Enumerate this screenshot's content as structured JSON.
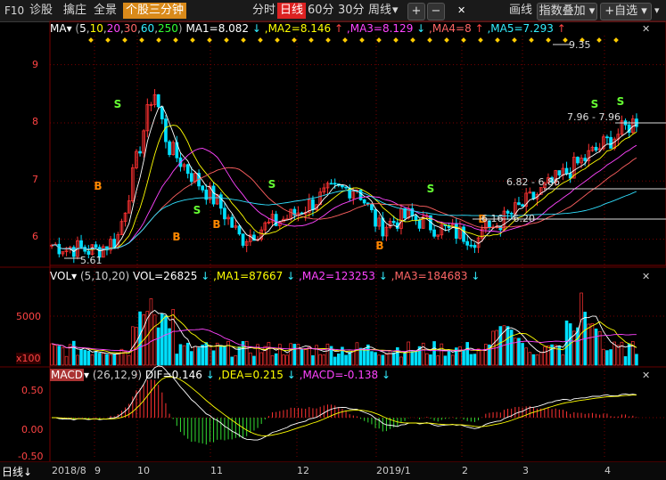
{
  "toolbar": {
    "f10": "F10",
    "diagnose": "诊股",
    "fetch": "擒庄",
    "fullscreen": "全景",
    "three_min": "个股三分钟",
    "periods": [
      "分时",
      "日线",
      "60分",
      "30分",
      "周线"
    ],
    "period_dropdown": "▾",
    "plus": "+",
    "minus": "−",
    "close": "✕",
    "draw_line": "画线",
    "index_overlay": "指数叠加",
    "add_watch": "+自选"
  },
  "colors": {
    "bg": "#000000",
    "up": "#ff3232",
    "down": "#00e0ff",
    "ma1": "#ffffff",
    "ma2": "#ffff00",
    "ma3": "#ff44ff",
    "ma4": "#ff6060",
    "ma5": "#30e0ff",
    "grid": "#7a0000",
    "dif": "#ffffff",
    "dea": "#ffff00"
  },
  "price_panel": {
    "indicator": "MA",
    "dropdown": "▾",
    "params_open": "(",
    "params": [
      "5",
      "10",
      "20",
      "30",
      "60",
      "250"
    ],
    "params_close": ")",
    "ma1": "MA1=8.082",
    "ma2": ",MA2=8.146",
    "ma3": ",MA3=8.129",
    "ma4": ",MA4=8",
    "ma5": ",MA5=7.293",
    "arrow_down": "↓",
    "arrow_up": "↑",
    "ymin": 5.55,
    "ymax": 9.5,
    "y_ticks": [
      {
        "v": 9,
        "label": "9"
      },
      {
        "v": 8,
        "label": "8"
      },
      {
        "v": 7,
        "label": "7"
      },
      {
        "v": 6,
        "label": "6"
      }
    ],
    "annotations": {
      "high": "9.35",
      "low": "5.61",
      "range1": "7.96 - 7.96",
      "range2": "6.82 - 6.86",
      "range3": "6.16 - 6.20"
    },
    "signal_b": "B",
    "signal_s": "S"
  },
  "vol_panel": {
    "indicator": "VOL",
    "dropdown": "▾",
    "params": "(5,10,20)",
    "vol": "VOL=26825",
    "ma1": ",MA1=87667",
    "ma2": ",MA2=123253",
    "ma3": ",MA3=184683",
    "arrow": "↓",
    "y_label": "5000",
    "unit": "x100"
  },
  "macd_panel": {
    "indicator": "MACD",
    "dropdown": "▾",
    "params": "(26,12,9)",
    "dif": "DIF=0.146",
    "dea": ",DEA=0.215",
    "macd": ",MACD=-0.138",
    "arrow": "↓",
    "y_ticks": [
      "0.50",
      "0.00",
      "-0.50"
    ]
  },
  "bottom": {
    "period": "日线",
    "arrow": "↓",
    "dates": [
      "2018/8",
      "9",
      "10",
      "11",
      "12",
      "2019/1",
      "2",
      "3",
      "4"
    ]
  }
}
